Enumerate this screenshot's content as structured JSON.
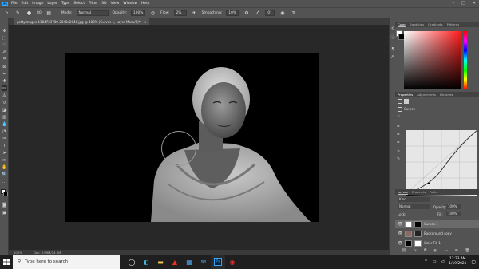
{
  "app": {
    "logo": "Ps"
  },
  "menu": [
    "File",
    "Edit",
    "Image",
    "Layer",
    "Type",
    "Select",
    "Filter",
    "3D",
    "View",
    "Window",
    "Help"
  ],
  "options": {
    "brush_size": "80",
    "mode_label": "Mode:",
    "mode_value": "Normal",
    "opacity_label": "Opacity:",
    "opacity_value": "100%",
    "flow_label": "Flow:",
    "flow_value": "2%",
    "smoothing_label": "Smoothing:",
    "smoothing_value": "10%",
    "angle_value": "0°"
  },
  "document": {
    "tab_title": "gettyimages-1184723780-2048x2048.jpg @ 100% (Curves 1, Layer Mask/8)*",
    "close": "×"
  },
  "status": {
    "zoom": "100%",
    "doc_size": "Doc: 3.99M/24.0M"
  },
  "color_panel": {
    "tabs": [
      "Color",
      "Swatches",
      "Gradients",
      "Patterns"
    ]
  },
  "properties_panel": {
    "tabs": [
      "Properties",
      "Adjustments",
      "Libraries"
    ],
    "layer_type": "Curves"
  },
  "layers_panel": {
    "tabs": [
      "Layers",
      "Channels",
      "Paths"
    ],
    "filter": "Kind",
    "blend": "Normal",
    "opacity_label": "Opacity:",
    "opacity_value": "100%",
    "lock_label": "Lock:",
    "fill_label": "Fill:",
    "fill_value": "100%",
    "layers": [
      {
        "name": "Curves 1",
        "selected": true
      },
      {
        "name": "Background copy",
        "selected": false
      },
      {
        "name": "Color Fill 1",
        "selected": false
      }
    ]
  },
  "taskbar": {
    "search_placeholder": "Type here to search",
    "time": "12:23 AM",
    "date": "1/19/2021",
    "apps": [
      "task-view-icon",
      "edge-icon",
      "file-explorer-icon",
      "acrobat-icon",
      "store-icon",
      "mail-icon",
      "photoshop-icon",
      "record-icon"
    ]
  },
  "colors": {
    "accent": "#31a8ff",
    "panel": "#535353",
    "workspace": "#282828"
  }
}
